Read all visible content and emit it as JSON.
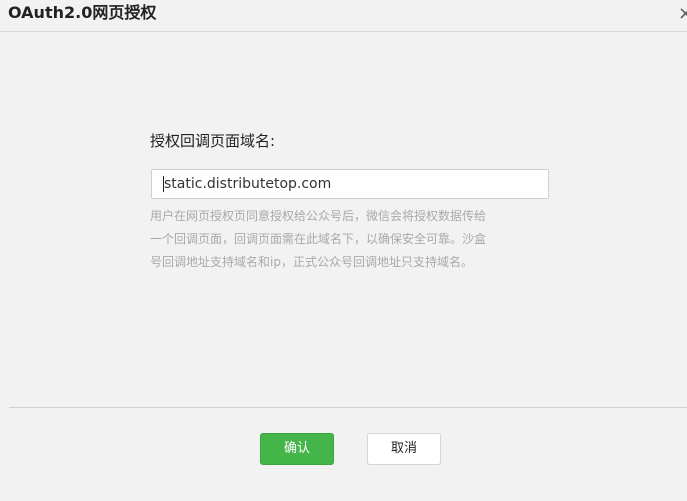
{
  "dialog": {
    "title": "OAuth2.0网页授权",
    "close_glyph": "×"
  },
  "form": {
    "label": "授权回调页面域名:",
    "input_value": "static.distributetop.com",
    "help_lines": [
      "用户在网页授权页同意授权给公众号后，微信会将授权数据传给",
      "一个回调页面，回调页面需在此域名下，以确保安全可靠。沙盒",
      "号回调地址支持域名和ip，正式公众号回调地址只支持域名。"
    ]
  },
  "actions": {
    "confirm_label": "确认",
    "cancel_label": "取消"
  },
  "colors": {
    "accent": "#44b549",
    "background": "#f2f2f2",
    "help_text": "#a9a9a9"
  },
  "icons": {
    "close": "close-icon"
  }
}
